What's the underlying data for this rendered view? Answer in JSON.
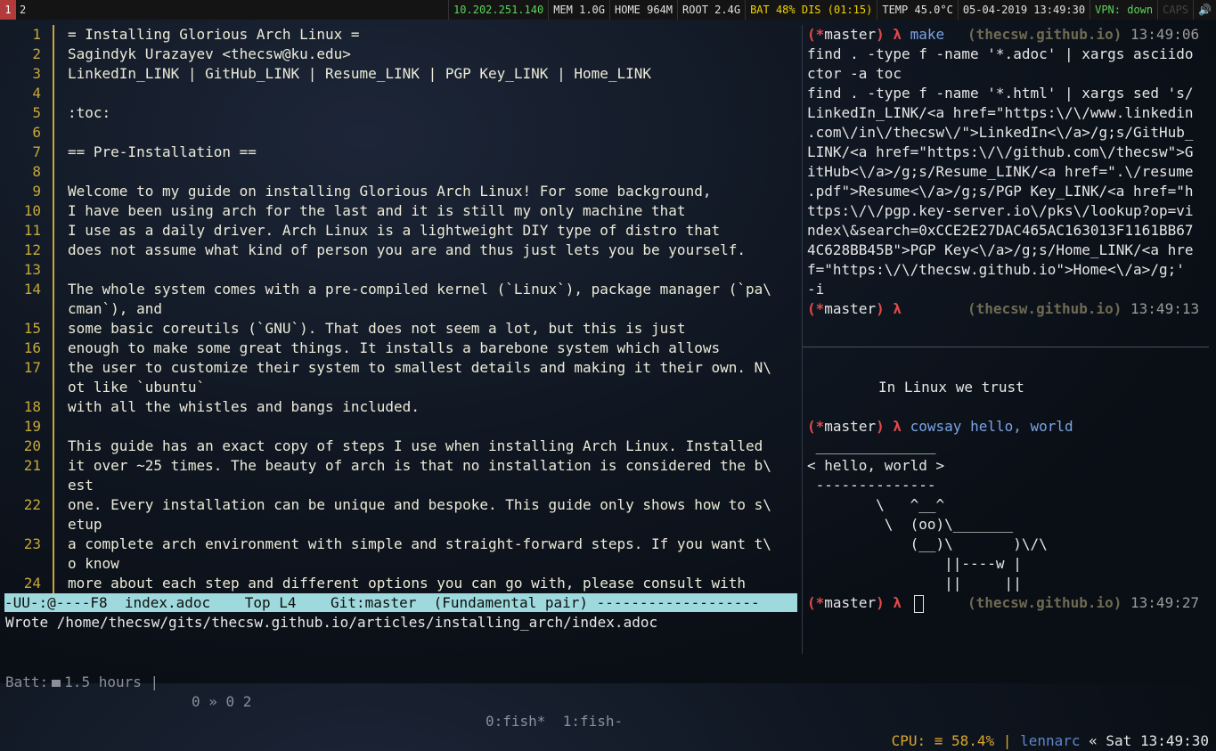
{
  "topbar": {
    "workspace_active": "1",
    "workspace_other": "2",
    "segments": [
      {
        "text": "10.202.251.140",
        "color": "#5ad35a"
      },
      {
        "text": "MEM 1.0G",
        "color": "#e0e0e0"
      },
      {
        "text": "HOME 964M",
        "color": "#e0e0e0"
      },
      {
        "text": "ROOT 2.4G",
        "color": "#e0e0e0"
      },
      {
        "text": "BAT 48% DIS (01:15)",
        "color": "#f0d200"
      },
      {
        "text": "TEMP 45.0°C",
        "color": "#e0e0e0"
      },
      {
        "text": "05-04-2019 13:49:30",
        "color": "#e0e0e0"
      },
      {
        "text": "VPN: down",
        "color": "#5ad35a"
      },
      {
        "text": "CAPS",
        "color": "#444444"
      },
      {
        "text": "🔊",
        "color": "#e0e0e0"
      }
    ]
  },
  "editor": {
    "lines": [
      {
        "num": "1",
        "text": "= Installing Glorious Arch Linux ="
      },
      {
        "num": "2",
        "text": "Sagindyk Urazayev <thecsw@ku.edu>"
      },
      {
        "num": "3",
        "text": "LinkedIn_LINK | GitHub_LINK | Resume_LINK | PGP Key_LINK | Home_LINK"
      },
      {
        "num": "4",
        "text": ""
      },
      {
        "num": "5",
        "text": ":toc:"
      },
      {
        "num": "6",
        "text": ""
      },
      {
        "num": "7",
        "text": "== Pre-Installation =="
      },
      {
        "num": "8",
        "text": ""
      },
      {
        "num": "9",
        "text": "Welcome to my guide on installing Glorious Arch Linux! For some background,"
      },
      {
        "num": "10",
        "text": "I have been using arch for the last and it is still my only machine that"
      },
      {
        "num": "11",
        "text": "I use as a daily driver. Arch Linux is a lightweight DIY type of distro that"
      },
      {
        "num": "12",
        "text": "does not assume what kind of person you are and thus just lets you be yourself."
      },
      {
        "num": "13",
        "text": ""
      },
      {
        "num": "14",
        "text": "The whole system comes with a pre-compiled kernel (`Linux`), package manager (`pa\\"
      },
      {
        "num": "",
        "text": "cman`), and"
      },
      {
        "num": "15",
        "text": "some basic coreutils (`GNU`). That does not seem a lot, but this is just"
      },
      {
        "num": "16",
        "text": "enough to make some great things. It installs a barebone system which allows"
      },
      {
        "num": "17",
        "text": "the user to customize their system to smallest details and making it their own. N\\"
      },
      {
        "num": "",
        "text": "ot like `ubuntu`"
      },
      {
        "num": "18",
        "text": "with all the whistles and bangs included."
      },
      {
        "num": "19",
        "text": ""
      },
      {
        "num": "20",
        "text": "This guide has an exact copy of steps I use when installing Arch Linux. Installed"
      },
      {
        "num": "21",
        "text": "it over ~25 times. The beauty of arch is that no installation is considered the b\\"
      },
      {
        "num": "",
        "text": "est"
      },
      {
        "num": "22",
        "text": "one. Every installation can be unique and bespoke. This guide only shows how to s\\"
      },
      {
        "num": "",
        "text": "etup"
      },
      {
        "num": "23",
        "text": "a complete arch environment with simple and straight-forward steps. If you want t\\"
      },
      {
        "num": "",
        "text": "o know"
      },
      {
        "num": "24",
        "text": "more about each step and different options you can go with, please consult with"
      }
    ],
    "modeline": "-UU-:@----F8  index.adoc    Top L4    Git:master  (Fundamental pair) -------------------",
    "echo": "Wrote /home/thecsw/gits/thecsw.github.io/articles/installing_arch/index.adoc"
  },
  "terminal": {
    "branch": "master",
    "lambda": "λ",
    "repo": "(thecsw.github.io)",
    "cmd1": "make",
    "time1": "13:49:06",
    "output1": [
      "find . -type f -name '*.adoc' | xargs asciido",
      "ctor -a toc",
      "find . -type f -name '*.html' | xargs sed 's/",
      "LinkedIn_LINK/<a href=\"https:\\/\\/www.linkedin",
      ".com\\/in\\/thecsw\\/\">LinkedIn<\\/a>/g;s/GitHub_",
      "LINK/<a href=\"https:\\/\\/github.com\\/thecsw\">G",
      "itHub<\\/a>/g;s/Resume_LINK/<a href=\".\\/resume",
      ".pdf\">Resume<\\/a>/g;s/PGP Key_LINK/<a href=\"h",
      "ttps:\\/\\/pgp.key-server.io\\/pks\\/lookup?op=vi",
      "ndex\\&search=0xCCE2E27DAC465AC163013F1161BB67",
      "4C628BB45B\">PGP Key<\\/a>/g;s/Home_LINK/<a hre",
      "f=\"https:\\/\\/thecsw.github.io\">Home<\\/a>/g;'",
      "-i"
    ],
    "time2": "13:49:13",
    "motto": "In Linux we trust",
    "cmd2": "cowsay hello, world",
    "cowsay": [
      " ______________",
      "< hello, world >",
      " --------------",
      "        \\   ^__^",
      "         \\  (oo)\\_______",
      "            (__)\\       )\\/\\",
      "                ||----w |",
      "                ||     ||"
    ],
    "time3": "13:49:27"
  },
  "bottombar": {
    "batt_label": "Batt:",
    "batt_value": "1.5 hours |",
    "session": "0 » 0 2",
    "windows": "0:fish*  1:fish-",
    "cpu": "CPU: ≡ 58.4% |",
    "host": "lennarc",
    "clock": "« Sat 13:49:30"
  }
}
